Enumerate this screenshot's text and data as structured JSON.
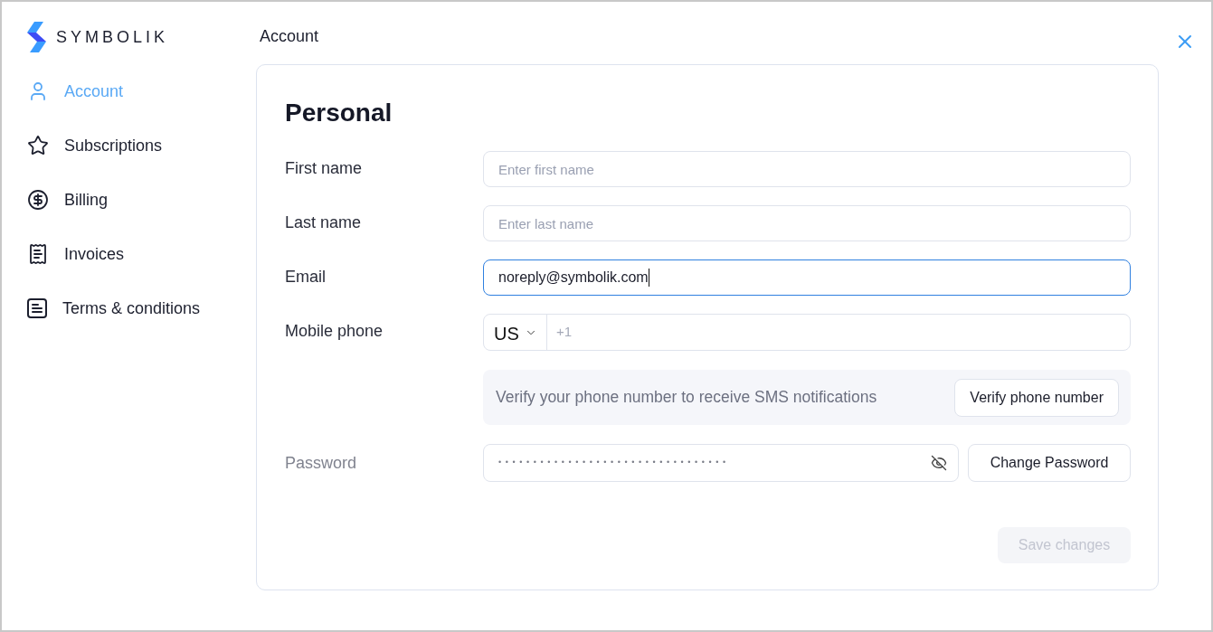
{
  "brand": {
    "name": "SYMBOLIK"
  },
  "sidebar": {
    "items": [
      {
        "label": "Account",
        "selected": true
      },
      {
        "label": "Subscriptions",
        "selected": false
      },
      {
        "label": "Billing",
        "selected": false
      },
      {
        "label": "Invoices",
        "selected": false
      },
      {
        "label": "Terms & conditions",
        "selected": false
      }
    ]
  },
  "page": {
    "title": "Account"
  },
  "form": {
    "title": "Personal",
    "fields": [
      {
        "kind": "text",
        "label": "First name",
        "placeholder": "Enter first name",
        "focused": false
      },
      {
        "kind": "text",
        "label": "Last name",
        "placeholder": "Enter last name",
        "focused": false
      },
      {
        "kind": "text",
        "label": "Email",
        "value": "noreply@symbolik.com",
        "focused": true
      },
      {
        "kind": "phone",
        "label": "Mobile phone",
        "country": "US",
        "placeholder": "+1",
        "focused": false
      }
    ],
    "verify_notice": {
      "text": "Verify your phone number to receive SMS notifications",
      "button": "Verify phone number"
    },
    "password": {
      "label": "Password",
      "dimmed": true,
      "value": "•••••••••••••••••••••••••••••••••",
      "button": "Change Password"
    },
    "save_button": {
      "label": "Save changes",
      "disabled": true
    }
  }
}
